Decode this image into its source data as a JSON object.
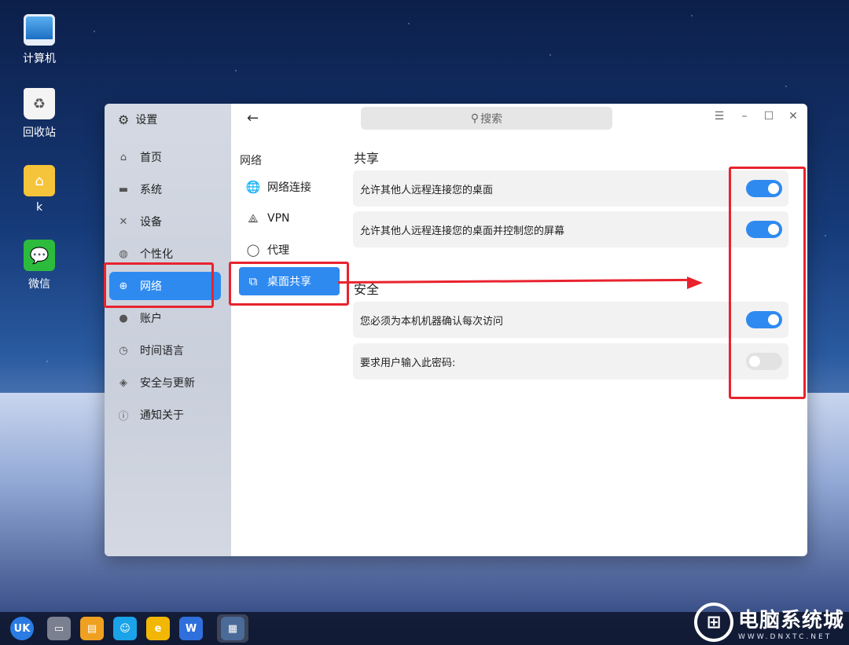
{
  "desktop": {
    "icons": [
      {
        "label": "计算机",
        "icon": "computer-icon"
      },
      {
        "label": "回收站",
        "icon": "trash-icon"
      },
      {
        "label": "k",
        "icon": "home-folder-icon"
      },
      {
        "label": "微信",
        "icon": "wechat-icon"
      }
    ]
  },
  "window": {
    "title": "设置",
    "search_placeholder": "搜索",
    "controls": {
      "menu": "☰",
      "minimize": "–",
      "maximize": "☐",
      "close": "✕"
    }
  },
  "sidebar": {
    "items": [
      {
        "label": "首页",
        "icon": "home-icon",
        "glyph": "⌂"
      },
      {
        "label": "系统",
        "icon": "monitor-icon",
        "glyph": "▬"
      },
      {
        "label": "设备",
        "icon": "tools-icon",
        "glyph": "✕"
      },
      {
        "label": "个性化",
        "icon": "palette-icon",
        "glyph": "◍"
      },
      {
        "label": "网络",
        "icon": "globe-icon",
        "glyph": "⊕",
        "active": true
      },
      {
        "label": "账户",
        "icon": "user-icon",
        "glyph": "●"
      },
      {
        "label": "时间语言",
        "icon": "clock-icon",
        "glyph": "◷"
      },
      {
        "label": "安全与更新",
        "icon": "shield-icon",
        "glyph": "◈"
      },
      {
        "label": "通知关于",
        "icon": "info-icon",
        "glyph": "ⓘ"
      }
    ]
  },
  "network_panel": {
    "title": "网络",
    "items": [
      {
        "label": "网络连接",
        "icon": "network-globe-icon",
        "glyph": "🌐"
      },
      {
        "label": "VPN",
        "icon": "vpn-icon",
        "glyph": "⟁"
      },
      {
        "label": "代理",
        "icon": "proxy-planet-icon",
        "glyph": "◯"
      },
      {
        "label": "桌面共享",
        "icon": "desktop-share-icon",
        "glyph": "⧉",
        "active": true
      }
    ]
  },
  "desktop_share": {
    "sharing": {
      "title": "共享",
      "rows": [
        {
          "label": "允许其他人远程连接您的桌面",
          "enabled": true
        },
        {
          "label": "允许其他人远程连接您的桌面并控制您的屏幕",
          "enabled": true
        }
      ]
    },
    "security": {
      "title": "安全",
      "rows": [
        {
          "label": "您必须为本机机器确认每次访问",
          "enabled": true
        },
        {
          "label": "要求用户输入此密码:",
          "enabled": false
        }
      ]
    }
  },
  "taskbar": {
    "items": [
      {
        "icon": "start-menu-icon",
        "glyph": "UK",
        "color": "#2a7be4"
      },
      {
        "icon": "show-desktop-icon",
        "glyph": "▭",
        "color": "#7a8090"
      },
      {
        "icon": "file-manager-icon",
        "glyph": "▤",
        "color": "#f0a020"
      },
      {
        "icon": "app-store-icon",
        "glyph": "☺",
        "color": "#1aa3e8"
      },
      {
        "icon": "browser-icon",
        "glyph": "e",
        "color": "#f2b705"
      },
      {
        "icon": "wps-writer-icon",
        "glyph": "W",
        "color": "#2f6fdc"
      },
      {
        "icon": "settings-window-icon",
        "glyph": "▦",
        "color": "#4a6a98"
      }
    ]
  },
  "watermark": {
    "main": "电脑系统城",
    "sub": "WWW.DNXTC.NET"
  },
  "colors": {
    "accent": "#2f8af0",
    "annotation": "#e8232e"
  }
}
